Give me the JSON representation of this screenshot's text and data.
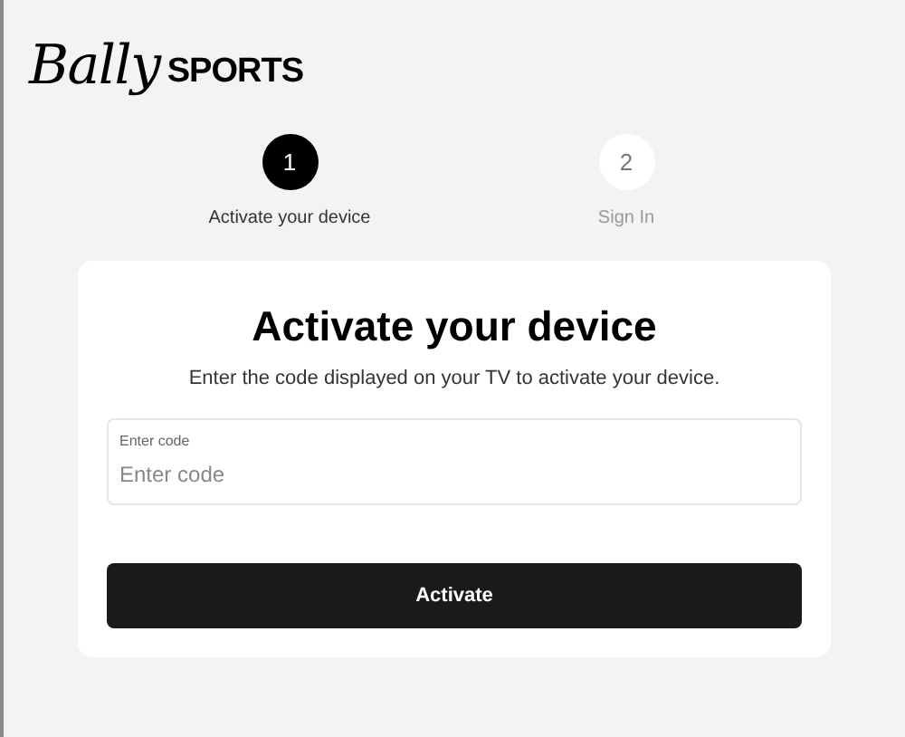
{
  "logo": {
    "script": "Bally",
    "word": "SPORTS"
  },
  "steps": [
    {
      "number": "1",
      "label": "Activate your device",
      "selected": true
    },
    {
      "number": "2",
      "label": "Sign In",
      "selected": false
    }
  ],
  "card": {
    "title": "Activate your device",
    "subtitle": "Enter the code displayed on your TV to activate your device.",
    "field": {
      "label": "Enter code",
      "placeholder": "Enter code"
    },
    "button": "Activate"
  }
}
